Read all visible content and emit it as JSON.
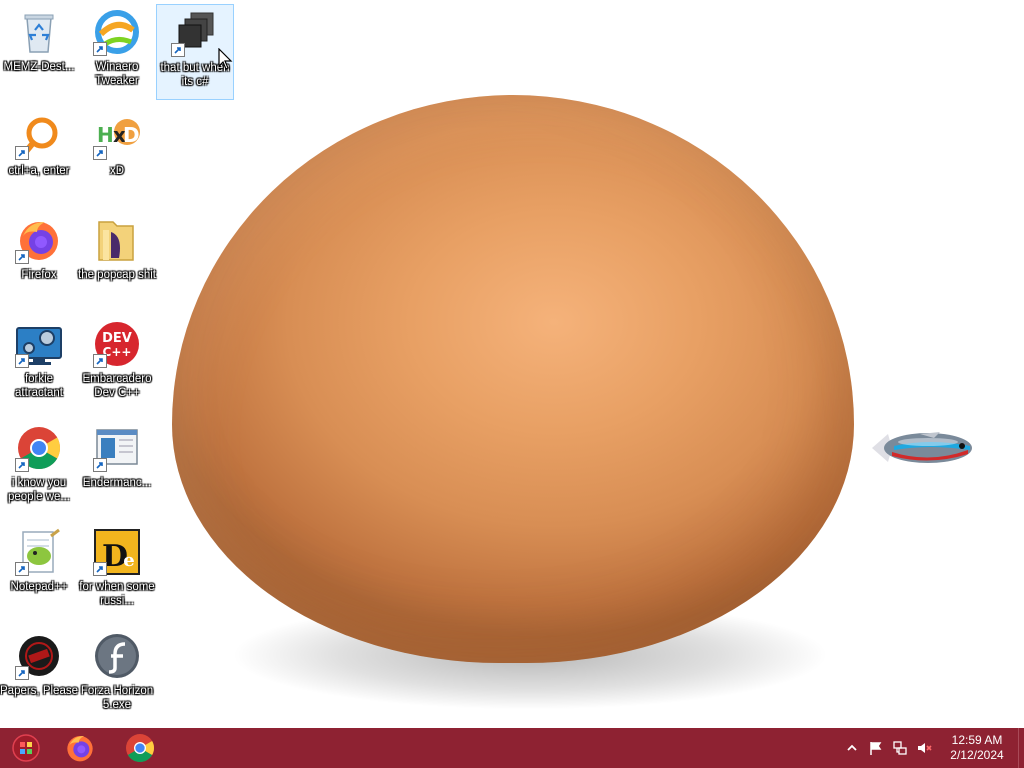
{
  "desktop": {
    "icons": [
      {
        "id": "memz",
        "label": "MEMZ-Dest...",
        "icon": "recycle-bin-icon"
      },
      {
        "id": "winaero",
        "label": "Winaero Tweaker",
        "icon": "winaero-icon"
      },
      {
        "id": "csharp",
        "label": "that but when its c#",
        "icon": "windows-stack-icon",
        "selected": true
      },
      {
        "id": "ctrl",
        "label": "ctrl+a, enter",
        "icon": "magnifier-icon"
      },
      {
        "id": "xd",
        "label": "xD",
        "icon": "hxd-icon"
      },
      {
        "id": "firefox",
        "label": "Firefox",
        "icon": "firefox-icon"
      },
      {
        "id": "popcap",
        "label": "the popcap shit",
        "icon": "folder-icon"
      },
      {
        "id": "forkie",
        "label": "forkie attractant",
        "icon": "monitor-gear-icon"
      },
      {
        "id": "devcpp",
        "label": "Embarcadero Dev C++",
        "icon": "dev-cpp-icon"
      },
      {
        "id": "chrome",
        "label": "i know you people we...",
        "icon": "chrome-icon"
      },
      {
        "id": "enderman",
        "label": "Endermanc...",
        "icon": "window-app-icon"
      },
      {
        "id": "notepad",
        "label": "Notepad++",
        "icon": "notepad-plus-plus-icon"
      },
      {
        "id": "decompiler",
        "label": "for when some russi...",
        "icon": "de-icon"
      },
      {
        "id": "papers",
        "label": "Papers, Please",
        "icon": "papers-please-icon"
      },
      {
        "id": "forza",
        "label": "Forza Horizon 5.exe",
        "icon": "flash-icon"
      }
    ]
  },
  "taskbar": {
    "color": "#8e2232",
    "start_icon": "start-orb-icon",
    "pinned": [
      {
        "id": "firefox",
        "icon": "firefox-icon"
      },
      {
        "id": "chrome",
        "icon": "chrome-icon"
      }
    ],
    "tray": {
      "icons": [
        "chevron-up-icon",
        "flag-icon",
        "network-icon",
        "volume-muted-icon"
      ],
      "time": "12:59 AM",
      "date": "2/12/2024"
    }
  },
  "wallpaper": {
    "egg_color": "#e0965a"
  }
}
